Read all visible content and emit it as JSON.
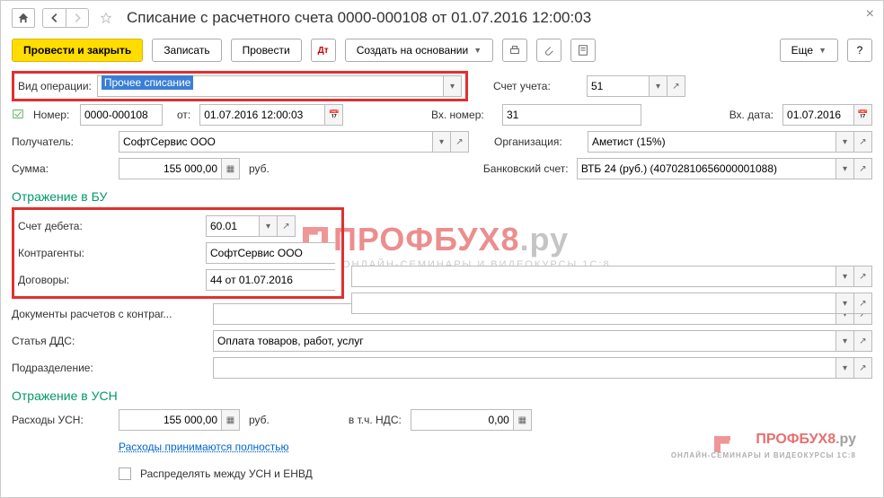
{
  "header": {
    "title": "Списание с расчетного счета 0000-000108 от 01.07.2016 12:00:03"
  },
  "toolbar": {
    "provesti_zakryt": "Провести и закрыть",
    "zapisat": "Записать",
    "provesti": "Провести",
    "sozdat": "Создать на основании",
    "eshche": "Еще"
  },
  "fields": {
    "vid_operacii_label": "Вид операции:",
    "vid_operacii": "Прочее списание",
    "schet_ucheta_label": "Счет учета:",
    "schet_ucheta": "51",
    "nomer_label": "Номер:",
    "nomer": "0000-000108",
    "ot_label": "от:",
    "ot": "01.07.2016 12:00:03",
    "vh_nomer_label": "Вх. номер:",
    "vh_nomer": "31",
    "vh_data_label": "Вх. дата:",
    "vh_data": "01.07.2016",
    "poluchatel_label": "Получатель:",
    "poluchatel": "СофтСервис ООО",
    "organizaciya_label": "Организация:",
    "organizaciya": "Аметист (15%)",
    "summa_label": "Сумма:",
    "summa": "155 000,00",
    "summa_cur": "руб.",
    "bank_schet_label": "Банковский счет:",
    "bank_schet": "ВТБ 24 (руб.) (40702810656000001088)"
  },
  "bu": {
    "title": "Отражение в БУ",
    "schet_debeta_label": "Счет дебета:",
    "schet_debeta": "60.01",
    "kontragenty_label": "Контрагенты:",
    "kontragenty": "СофтСервис ООО",
    "dogovory_label": "Договоры:",
    "dogovory": "44 от 01.07.2016",
    "dokumenty_label": "Документы расчетов с контраг...",
    "statya_dds_label": "Статья ДДС:",
    "statya_dds": "Оплата товаров, работ, услуг",
    "podrazdelenie_label": "Подразделение:"
  },
  "usn": {
    "title": "Отражение в УСН",
    "rashody_label": "Расходы УСН:",
    "rashody": "155 000,00",
    "rashody_cur": "руб.",
    "nds_label": "в т.ч. НДС:",
    "nds": "0,00",
    "link": "Расходы принимаются полностью",
    "checkbox_label": "Распределять между УСН и ЕНВД"
  },
  "watermark": {
    "big1": "ПРОФБУХ8",
    "big2": ".ру",
    "sub": "ОНЛАЙН-СЕМИНАРЫ И ВИДЕОКУРСЫ 1С:8"
  }
}
